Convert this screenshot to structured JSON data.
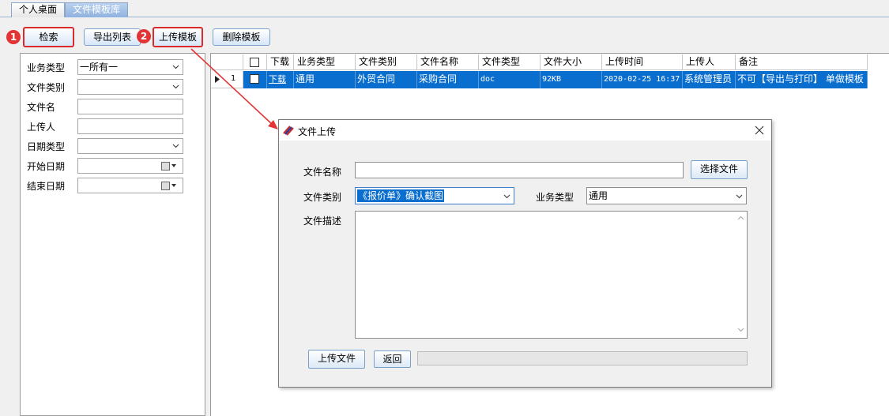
{
  "tabs": [
    {
      "label": "个人桌面",
      "active": false
    },
    {
      "label": "文件模板库",
      "active": true
    }
  ],
  "toolbar": {
    "search": "检索",
    "export_list": "导出列表",
    "upload_template": "上传模板",
    "delete_template": "删除模板",
    "step1": "1",
    "step2": "2"
  },
  "filters": {
    "business_type_label": "业务类型",
    "business_type_value": "一所有一",
    "file_category_label": "文件类别",
    "file_name_label": "文件名",
    "uploader_label": "上传人",
    "date_type_label": "日期类型",
    "start_date_label": "开始日期",
    "end_date_label": "结束日期"
  },
  "grid": {
    "headers": [
      "下载",
      "业务类型",
      "文件类别",
      "文件名称",
      "文件类型",
      "文件大小",
      "上传时间",
      "上传人",
      "备注"
    ],
    "rows": [
      {
        "index": "1",
        "download": "下载",
        "business_type": "通用",
        "file_category": "外贸合同",
        "file_name": "采购合同",
        "file_type": "doc",
        "file_size": "92KB",
        "upload_time": "2020-02-25 16:37",
        "uploader": "系统管理员",
        "note": "不可【导出与打印】 单做模板"
      }
    ]
  },
  "dialog": {
    "title": "文件上传",
    "file_name_label": "文件名称",
    "file_name_value": "",
    "choose_file": "选择文件",
    "file_category_label": "文件类别",
    "file_category_value": "《报价单》确认截图",
    "business_type_label": "业务类型",
    "business_type_value": "通用",
    "description_label": "文件描述",
    "upload_button": "上传文件",
    "back_button": "返回"
  },
  "colors": {
    "highlight": "#d92b2b",
    "selection": "#0a6ecf",
    "arrow": "#e23434"
  }
}
